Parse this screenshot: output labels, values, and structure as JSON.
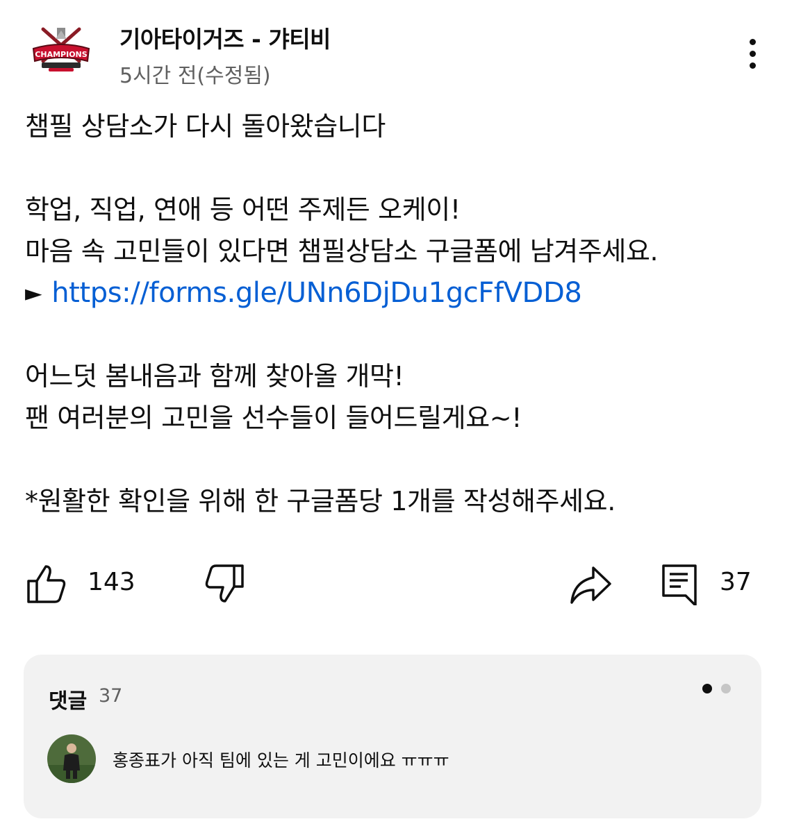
{
  "channel": {
    "name": "기아타이거즈 - 갸티비",
    "time": "5시간 전(수정됨)",
    "avatar_icon": "champions-logo-icon"
  },
  "post": {
    "lines": [
      "챔필 상담소가 다시 돌아왔습니다",
      "",
      "학업, 직업, 연애 등 어떤 주제든 오케이!",
      "마음 속 고민들이 있다면 챔필상담소 구글폼에 남겨주세요."
    ],
    "link_arrow": "►",
    "link": "https://forms.gle/UNn6DjDu1gcFfVDD8",
    "lines_after": [
      "",
      "어느덧 봄내음과 함께 찾아올 개막!",
      "팬 여러분의 고민을 선수들이 들어드릴게요~!",
      "",
      "*원활한 확인을 위해 한 구글폼당 1개를 작성해주세요."
    ]
  },
  "actions": {
    "like_count": "143",
    "comment_count": "37",
    "like_icon": "thumbs-up-icon",
    "dislike_icon": "thumbs-down-icon",
    "share_icon": "share-icon",
    "comment_icon": "comment-icon"
  },
  "comments": {
    "title": "댓글",
    "count": "37",
    "first_comment": "홍종표가 아직 팀에 있는 게 고민이에요  ㅠㅠㅠ",
    "commenter_avatar_icon": "user-avatar-icon"
  },
  "colors": {
    "link": "#065fd4",
    "text": "#0f0f0f",
    "secondary_text": "#606060",
    "comment_box_bg": "#f2f2f2"
  }
}
